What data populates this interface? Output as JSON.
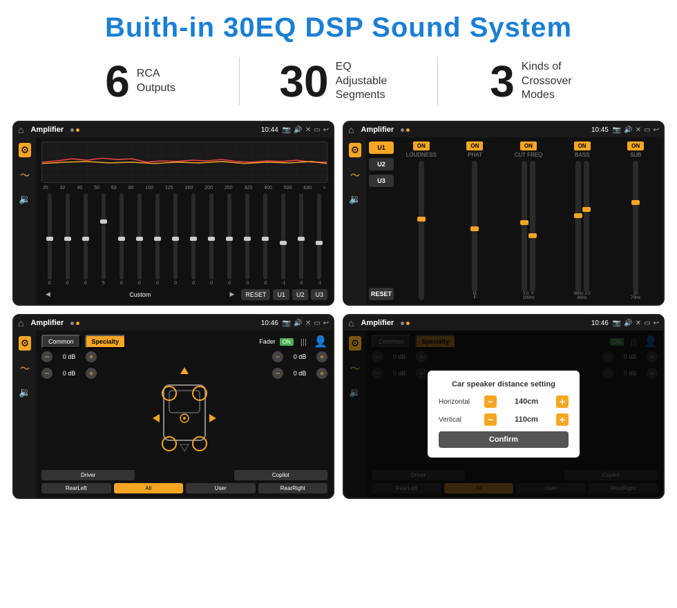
{
  "page": {
    "title": "Buith-in 30EQ DSP Sound System"
  },
  "stats": [
    {
      "number": "6",
      "label": "RCA\nOutputs"
    },
    {
      "number": "30",
      "label": "EQ Adjustable\nSegments"
    },
    {
      "number": "3",
      "label": "Kinds of\nCrossover Modes"
    }
  ],
  "screens": [
    {
      "id": "screen1",
      "title": "Amplifier",
      "time": "10:44",
      "type": "eq",
      "freqs": [
        "25",
        "32",
        "40",
        "50",
        "63",
        "80",
        "100",
        "125",
        "160",
        "200",
        "250",
        "320",
        "400",
        "500",
        "630"
      ],
      "sliderValues": [
        "0",
        "0",
        "0",
        "5",
        "0",
        "0",
        "0",
        "0",
        "0",
        "0",
        "0",
        "0",
        "0",
        "-1",
        "0",
        "-1"
      ],
      "bottomBtns": [
        "Custom",
        "RESET",
        "U1",
        "U2",
        "U3"
      ]
    },
    {
      "id": "screen2",
      "title": "Amplifier",
      "time": "10:45",
      "type": "crossover",
      "presets": [
        "U1",
        "U2",
        "U3"
      ],
      "controls": [
        {
          "toggle": "ON",
          "label": "LOUDNESS"
        },
        {
          "toggle": "ON",
          "label": "PHAT"
        },
        {
          "toggle": "ON",
          "label": "CUT FREQ"
        },
        {
          "toggle": "ON",
          "label": "BASS"
        },
        {
          "toggle": "ON",
          "label": "SUB"
        }
      ]
    },
    {
      "id": "screen3",
      "title": "Amplifier",
      "time": "10:46",
      "type": "fader",
      "tabs": [
        "Common",
        "Specialty"
      ],
      "activeTab": "Specialty",
      "faderLabel": "Fader",
      "faderOn": true,
      "dbValues": [
        "0 dB",
        "0 dB",
        "0 dB",
        "0 dB"
      ],
      "bottomBtns": [
        "Driver",
        "",
        "Copilot",
        "RearLeft",
        "All",
        "User",
        "RearRight"
      ]
    },
    {
      "id": "screen4",
      "title": "Amplifier",
      "time": "10:46",
      "type": "fader-dialog",
      "tabs": [
        "Common",
        "Specialty"
      ],
      "activeTab": "Specialty",
      "dialog": {
        "title": "Car speaker distance setting",
        "rows": [
          {
            "label": "Horizontal",
            "value": "140cm"
          },
          {
            "label": "Vertical",
            "value": "110cm"
          }
        ],
        "confirmLabel": "Confirm"
      },
      "bottomBtns": [
        "Driver",
        "Copilot",
        "RearLeft",
        "User",
        "RearRight"
      ]
    }
  ]
}
